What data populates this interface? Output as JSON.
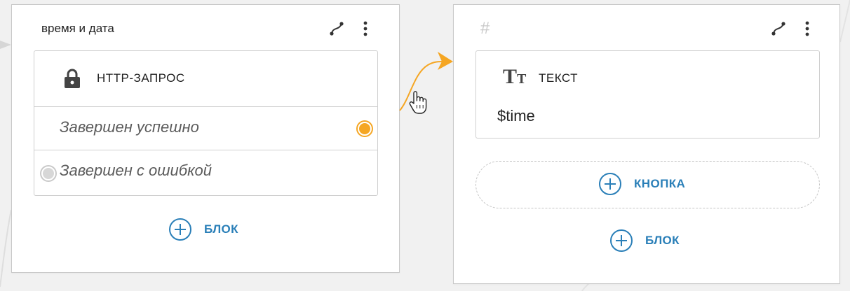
{
  "left_card": {
    "title": "время и дата",
    "block": {
      "label": "HTTP-ЗАПРОС",
      "icon": "lock-icon",
      "outputs": [
        {
          "label": "Завершен успешно",
          "connected": true
        },
        {
          "label": "Завершен с ошибкой",
          "connected": false
        }
      ]
    },
    "add_block_label": "БЛОК"
  },
  "right_card": {
    "title_placeholder": "#",
    "block": {
      "label": "ТЕКСТ",
      "icon": "text-type-icon",
      "value": "$time"
    },
    "add_button_label": "КНОПКА",
    "add_block_label": "БЛОК"
  },
  "colors": {
    "accent": "#2a7fb8",
    "connection": "#f5a623",
    "inactive_port": "#d7d7d7"
  }
}
